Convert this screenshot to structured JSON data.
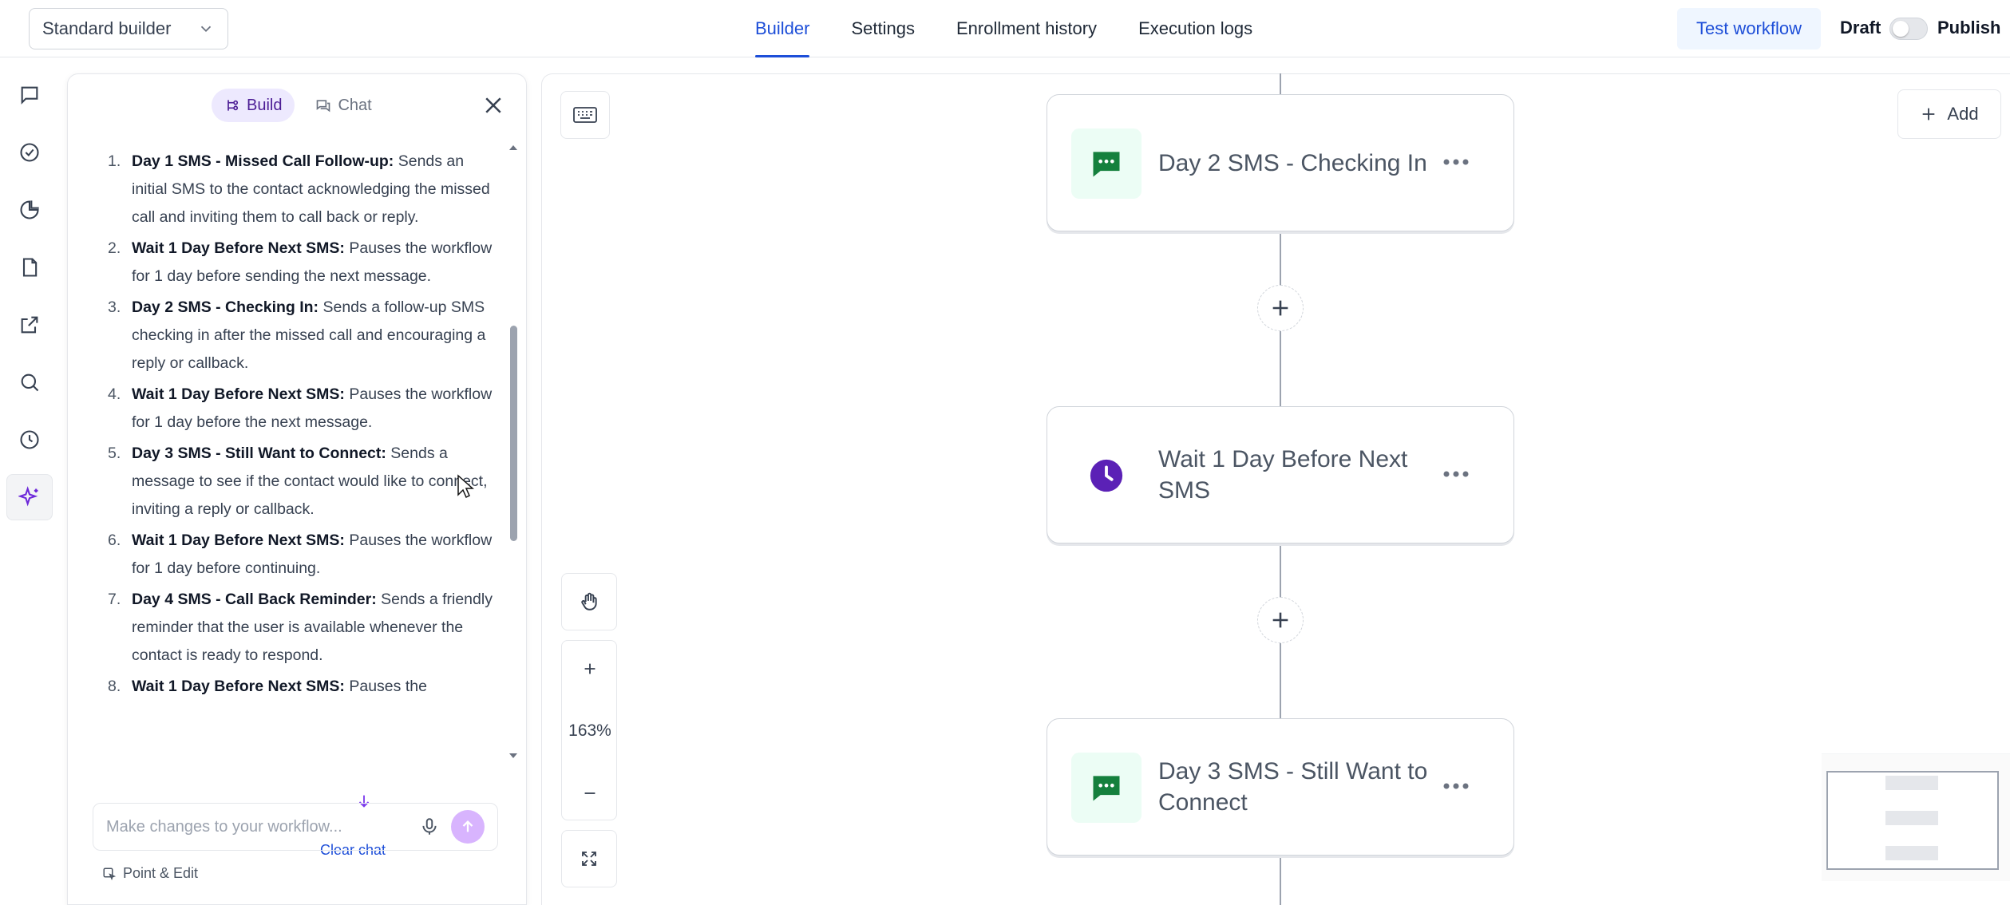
{
  "topbar": {
    "builder_select": "Standard builder",
    "tabs": [
      {
        "label": "Builder",
        "active": true
      },
      {
        "label": "Settings",
        "active": false
      },
      {
        "label": "Enrollment history",
        "active": false
      },
      {
        "label": "Execution logs",
        "active": false
      }
    ],
    "test_workflow": "Test workflow",
    "draft": "Draft",
    "publish": "Publish"
  },
  "panel": {
    "build_label": "Build",
    "chat_label": "Chat",
    "steps": [
      {
        "num": "1.",
        "title": "Day 1 SMS - Missed Call Follow-up:",
        "desc": " Sends an initial SMS to the contact acknowledging the missed call and inviting them to call back or reply."
      },
      {
        "num": "2.",
        "title": "Wait 1 Day Before Next SMS:",
        "desc": " Pauses the workflow for 1 day before sending the next message."
      },
      {
        "num": "3.",
        "title": "Day 2 SMS - Checking In:",
        "desc": " Sends a follow-up SMS checking in after the missed call and encouraging a reply or callback."
      },
      {
        "num": "4.",
        "title": "Wait 1 Day Before Next SMS:",
        "desc": " Pauses the workflow for 1 day before the next message."
      },
      {
        "num": "5.",
        "title": "Day 3 SMS - Still Want to Connect:",
        "desc": " Sends a message to see if the contact would like to connect, inviting a reply or callback."
      },
      {
        "num": "6.",
        "title": "Wait 1 Day Before Next SMS:",
        "desc": " Pauses the workflow for 1 day before continuing."
      },
      {
        "num": "7.",
        "title": "Day 4 SMS - Call Back Reminder:",
        "desc": " Sends a friendly reminder that the user is available whenever the contact is ready to respond."
      },
      {
        "num": "8.",
        "title": "Wait 1 Day Before Next SMS:",
        "desc": " Pauses the"
      }
    ],
    "clear_chat": "Clear chat",
    "composer_placeholder": "Make changes to your workflow...",
    "point_edit": "Point & Edit"
  },
  "canvas": {
    "add_label": "Add",
    "zoom_level": "163%",
    "nodes": [
      {
        "title": "Day 2 SMS - Checking In",
        "icon": "sms-icon"
      },
      {
        "title": "Wait 1 Day Before Next SMS",
        "icon": "clock-icon"
      },
      {
        "title": "Day 3 SMS - Still Want to Connect",
        "icon": "sms-icon"
      }
    ]
  },
  "colors": {
    "accent": "#1d4ed8",
    "sms_green": "#15803d",
    "wait_purple": "#5b21b6",
    "build_purple": "#ede9fe"
  }
}
